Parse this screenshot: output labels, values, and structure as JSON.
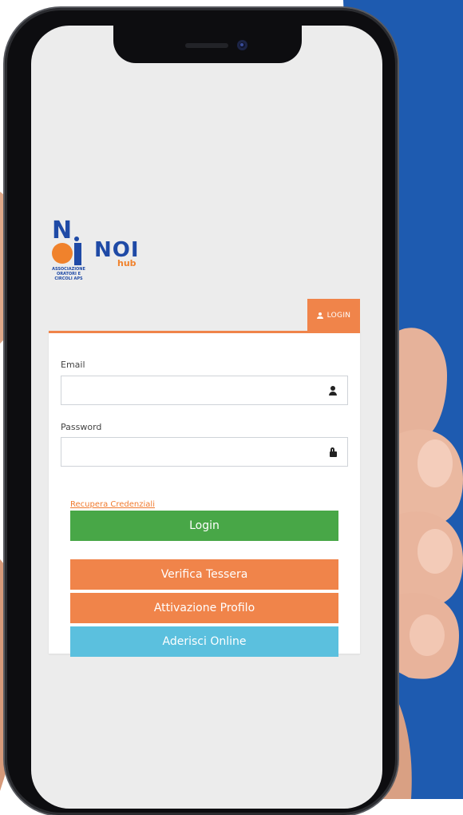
{
  "app": {
    "brand": {
      "logo_letter": "N",
      "logo_caption": "ASSOCIAZIONE ORATORI E CIRCOLI APS",
      "product_name": "NOI",
      "product_suffix": "hub"
    },
    "tab": {
      "label": "LOGIN",
      "icon": "user-icon"
    },
    "form": {
      "email_label": "Email",
      "email_value": "",
      "email_icon": "user-icon",
      "password_label": "Password",
      "password_value": "",
      "password_icon": "lock-icon",
      "recover_link": "Recupera Credenziali"
    },
    "buttons": {
      "login": "Login",
      "verify_card": "Verifica Tessera",
      "activate_profile": "Attivazione Profilo",
      "join_online": "Aderisci Online"
    }
  },
  "colors": {
    "background_blue": "#1e5bb0",
    "accent_orange": "#f0844a",
    "login_green": "#48a747",
    "join_blue": "#5bc0de",
    "brand_blue": "#1f4aa6"
  }
}
